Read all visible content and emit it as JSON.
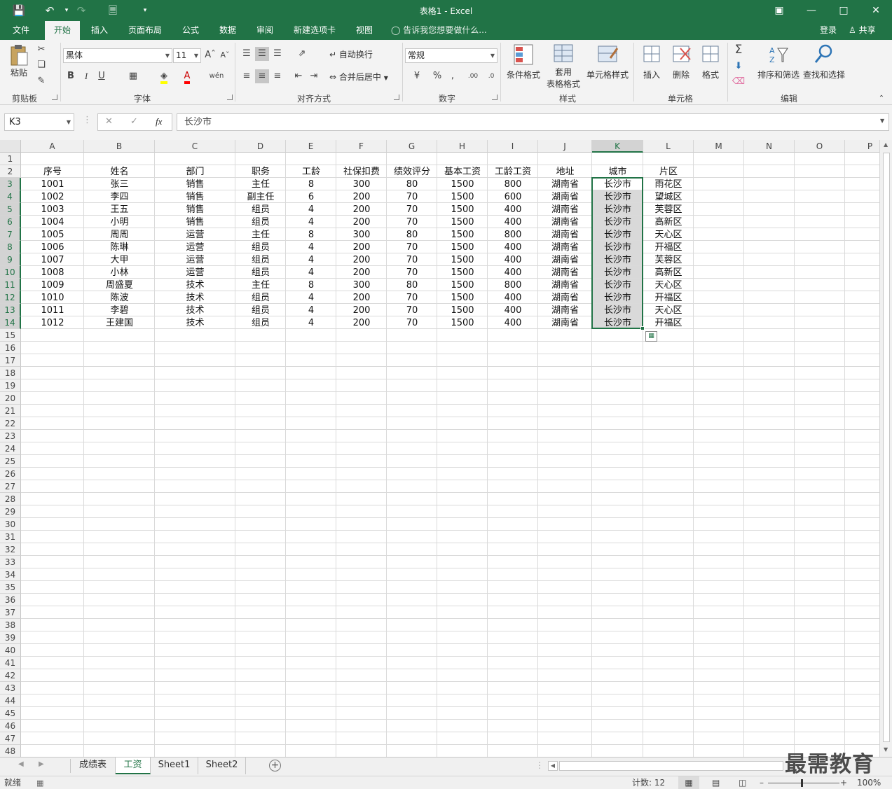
{
  "window": {
    "title": "表格1 - Excel",
    "accent": "#217346"
  },
  "quick_access": {
    "icons": [
      "save-icon",
      "undo-icon",
      "redo-icon",
      "new-file-icon",
      "customize-icon"
    ]
  },
  "tabs": [
    "文件",
    "开始",
    "插入",
    "页面布局",
    "公式",
    "数据",
    "审阅",
    "新建选项卡",
    "视图"
  ],
  "active_tab": "开始",
  "tell_me": "告诉我您想要做什么...",
  "account": {
    "signin": "登录",
    "share": "共享"
  },
  "ribbon": {
    "clipboard": {
      "label": "剪贴板",
      "paste": "粘贴"
    },
    "font": {
      "label": "字体",
      "name": "黑体",
      "size": "11",
      "bold": "B",
      "italic": "I",
      "underline": "U"
    },
    "alignment": {
      "label": "对齐方式",
      "wrap": "自动换行",
      "merge": "合并后居中"
    },
    "number": {
      "label": "数字",
      "format": "常规"
    },
    "styles": {
      "label": "样式",
      "conditional": "条件格式",
      "table_1": "套用",
      "table_2": "表格格式",
      "cell_styles": "单元格样式"
    },
    "cells": {
      "label": "单元格",
      "insert": "插入",
      "delete": "删除",
      "format": "格式"
    },
    "editing": {
      "label": "编辑",
      "sort": "排序和筛选",
      "find": "查找和选择"
    }
  },
  "formula_bar": {
    "name_box": "K3",
    "content": "长沙市",
    "fx": "fx"
  },
  "grid": {
    "columns": [
      "A",
      "B",
      "C",
      "D",
      "E",
      "F",
      "G",
      "H",
      "I",
      "J",
      "K",
      "L",
      "M",
      "N",
      "O",
      "P"
    ],
    "row_numbers": [
      "1",
      "2",
      "3",
      "4",
      "5",
      "6",
      "7",
      "8",
      "9",
      "10",
      "11",
      "12",
      "13",
      "14",
      "15",
      "16",
      "17",
      "18",
      "19",
      "20",
      "21",
      "22",
      "23",
      "24",
      "25",
      "26",
      "27",
      "28",
      "29",
      "30",
      "31",
      "32",
      "33",
      "34",
      "35",
      "36",
      "37",
      "38",
      "39",
      "40",
      "41",
      "42",
      "43",
      "44",
      "45",
      "46",
      "47",
      "48"
    ],
    "selected_column": "K",
    "headers": [
      "序号",
      "姓名",
      "部门",
      "职务",
      "工龄",
      "社保扣费",
      "绩效评分",
      "基本工资",
      "工龄工资",
      "地址",
      "城市",
      "片区"
    ],
    "rows": [
      [
        "1001",
        "张三",
        "销售",
        "主任",
        "8",
        "300",
        "80",
        "1500",
        "800",
        "湖南省",
        "长沙市",
        "雨花区"
      ],
      [
        "1002",
        "李四",
        "销售",
        "副主任",
        "6",
        "200",
        "70",
        "1500",
        "600",
        "湖南省",
        "长沙市",
        "望城区"
      ],
      [
        "1003",
        "王五",
        "销售",
        "组员",
        "4",
        "200",
        "70",
        "1500",
        "400",
        "湖南省",
        "长沙市",
        "芙蓉区"
      ],
      [
        "1004",
        "小明",
        "销售",
        "组员",
        "4",
        "200",
        "70",
        "1500",
        "400",
        "湖南省",
        "长沙市",
        "高新区"
      ],
      [
        "1005",
        "周周",
        "运营",
        "主任",
        "8",
        "300",
        "80",
        "1500",
        "800",
        "湖南省",
        "长沙市",
        "天心区"
      ],
      [
        "1006",
        "陈琳",
        "运营",
        "组员",
        "4",
        "200",
        "70",
        "1500",
        "400",
        "湖南省",
        "长沙市",
        "开福区"
      ],
      [
        "1007",
        "大甲",
        "运营",
        "组员",
        "4",
        "200",
        "70",
        "1500",
        "400",
        "湖南省",
        "长沙市",
        "芙蓉区"
      ],
      [
        "1008",
        "小林",
        "运营",
        "组员",
        "4",
        "200",
        "70",
        "1500",
        "400",
        "湖南省",
        "长沙市",
        "高新区"
      ],
      [
        "1009",
        "周盛夏",
        "技术",
        "主任",
        "8",
        "300",
        "80",
        "1500",
        "800",
        "湖南省",
        "长沙市",
        "天心区"
      ],
      [
        "1010",
        "陈波",
        "技术",
        "组员",
        "4",
        "200",
        "70",
        "1500",
        "400",
        "湖南省",
        "长沙市",
        "开福区"
      ],
      [
        "1011",
        "李碧",
        "技术",
        "组员",
        "4",
        "200",
        "70",
        "1500",
        "400",
        "湖南省",
        "长沙市",
        "天心区"
      ],
      [
        "1012",
        "王建国",
        "技术",
        "组员",
        "4",
        "200",
        "70",
        "1500",
        "400",
        "湖南省",
        "长沙市",
        "开福区"
      ]
    ]
  },
  "sheets": [
    "成绩表",
    "工资",
    "Sheet1",
    "Sheet2"
  ],
  "active_sheet": "工资",
  "status": {
    "ready": "就绪",
    "count": "计数: 12",
    "zoom": "100%"
  },
  "watermark": "最需教育"
}
